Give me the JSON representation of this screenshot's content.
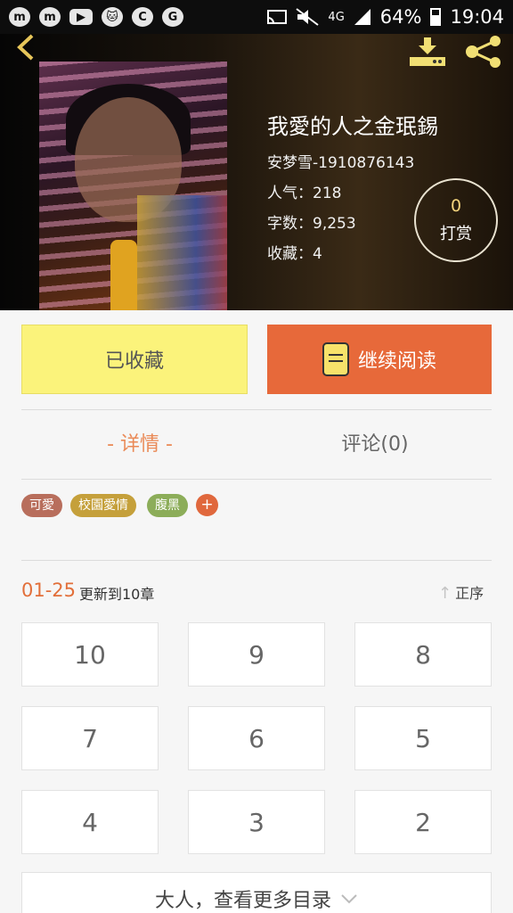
{
  "status_bar": {
    "app_icons": [
      "m",
      "m",
      "▶",
      "🐱",
      "C",
      "G"
    ],
    "network": "4G",
    "battery": "64%",
    "time": "19:04"
  },
  "book": {
    "title": "我愛的人之金珉錫",
    "author": "安梦雪-1910876143",
    "popularity": "人气：218",
    "word_count": "字数：9,253",
    "favorites": "收藏：4"
  },
  "reward": {
    "count": "0",
    "label": "打赏"
  },
  "actions": {
    "collected": "已收藏",
    "continue_reading": "继续阅读"
  },
  "tabs": {
    "details": "- 详情 -",
    "comments": "评论(0)"
  },
  "tags": [
    "可愛",
    "校園愛情",
    "腹黑"
  ],
  "tag_add": "+",
  "chapters": {
    "range": "01-25",
    "update": "更新到10章",
    "order": "正序",
    "items": [
      "10",
      "9",
      "8",
      "7",
      "6",
      "5",
      "4",
      "3",
      "2"
    ],
    "more": "大人，查看更多目录"
  },
  "colors": {
    "accent": "#e7693a",
    "collected_bg": "#fbf37b",
    "tab_active": "#ea8a57"
  },
  "icons": [
    "back-icon",
    "download-icon",
    "share-icon",
    "book-icon",
    "sort-arrow-icon",
    "chevron-down-icon"
  ]
}
